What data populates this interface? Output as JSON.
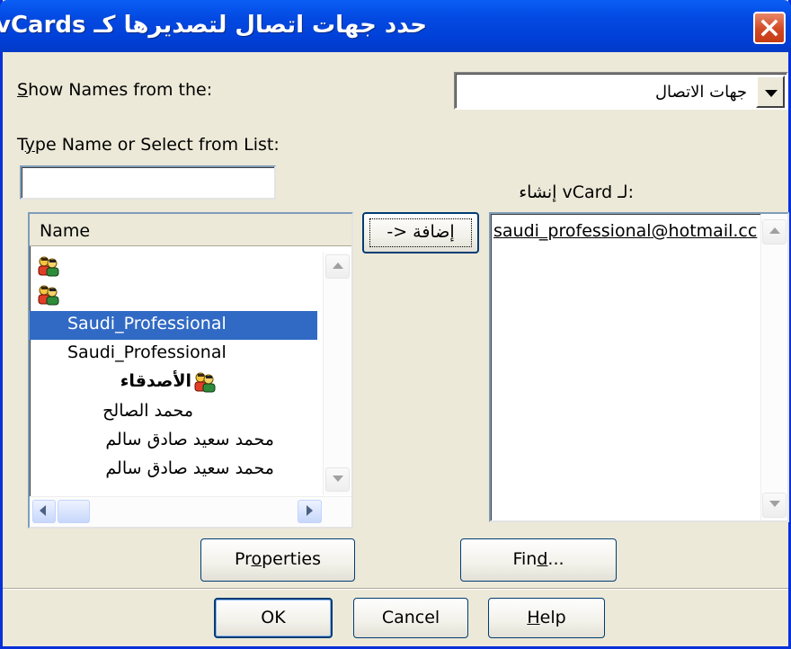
{
  "window": {
    "title": ":vCards حدد جهات اتصال لتصديرها كـ"
  },
  "show_names": {
    "label": "Show Names from the:",
    "selected": "جهات الاتصال"
  },
  "type_name": {
    "label": "Type Name or Select from List:",
    "value": ""
  },
  "name_list": {
    "header": "Name",
    "items": [
      {
        "label": "",
        "icon": "group-icon",
        "selected": false
      },
      {
        "label": "",
        "icon": "group-icon",
        "selected": false
      },
      {
        "label": "Saudi_Professional",
        "icon": "",
        "selected": true
      },
      {
        "label": "Saudi_Professional",
        "icon": "",
        "selected": false
      },
      {
        "label": "الأصدقاء",
        "icon": "group-icon",
        "selected": false
      },
      {
        "label": "محمد الصالح",
        "icon": "",
        "selected": false
      },
      {
        "label": "محمد سعيد صادق سالم",
        "icon": "",
        "selected": false
      },
      {
        "label": "محمد سعيد صادق سالم",
        "icon": "",
        "selected": false
      }
    ]
  },
  "add_button": {
    "label": "-> إضافة"
  },
  "vcard_list": {
    "label": ":لـ vCard إنشاء",
    "items": [
      "saudi_professional@hotmail.cc"
    ]
  },
  "buttons": {
    "properties": "Properties",
    "find": "Find...",
    "ok": "OK",
    "cancel": "Cancel",
    "help": "Help"
  },
  "colors": {
    "titlebar": "#0349e1",
    "selection": "#316ac5",
    "dialog_bg": "#ece9d8",
    "close_button": "#d24a23"
  }
}
